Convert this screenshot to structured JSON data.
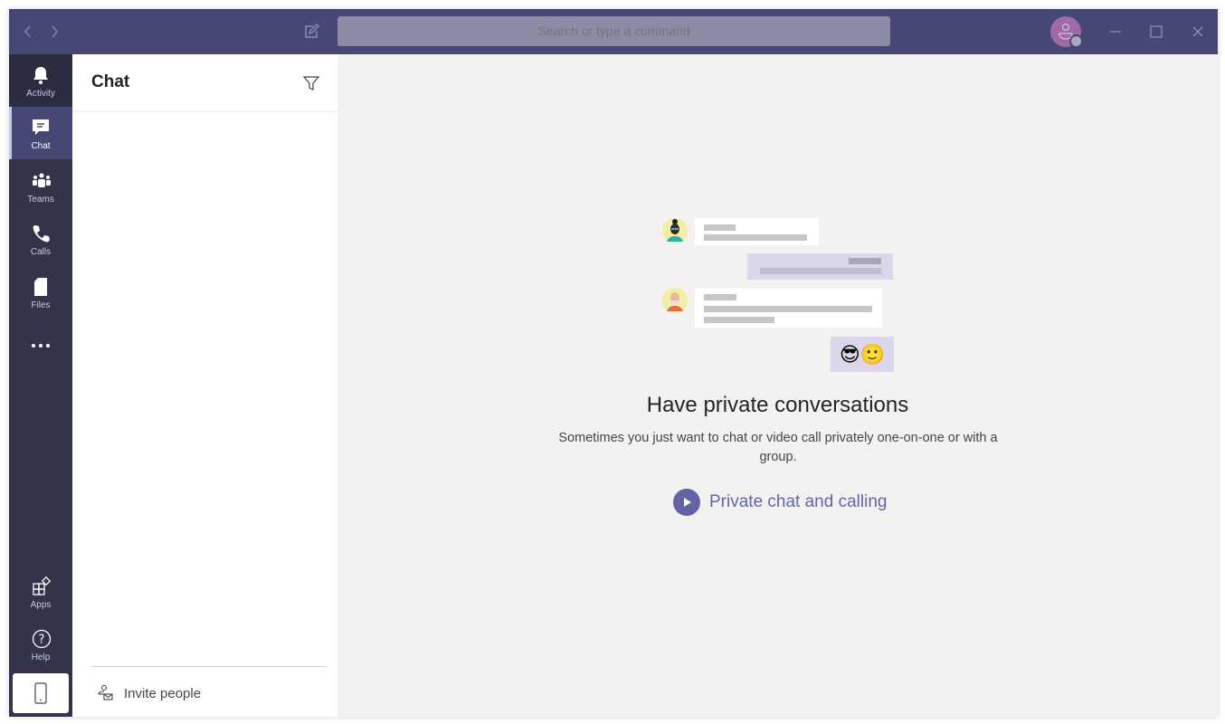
{
  "titlebar": {
    "back_icon": "chevron-left-icon",
    "forward_icon": "chevron-right-icon",
    "compose_icon": "compose-icon",
    "search_placeholder": "Search or type a command",
    "avatar_status": "offline",
    "minimize_icon": "minimize-icon",
    "maximize_icon": "maximize-icon",
    "close_icon": "close-icon"
  },
  "rail": {
    "items": [
      {
        "label": "Activity",
        "icon": "bell-icon"
      },
      {
        "label": "Chat",
        "icon": "chat-icon",
        "active": true
      },
      {
        "label": "Teams",
        "icon": "teams-icon"
      },
      {
        "label": "Calls",
        "icon": "phone-icon"
      },
      {
        "label": "Files",
        "icon": "file-icon"
      },
      {
        "label": "",
        "icon": "more-icon"
      }
    ],
    "bottom": [
      {
        "label": "Apps",
        "icon": "apps-icon"
      },
      {
        "label": "Help",
        "icon": "help-icon"
      },
      {
        "label": "",
        "icon": "mobile-icon"
      }
    ]
  },
  "chat_list": {
    "title": "Chat",
    "filter_icon": "filter-icon",
    "invite_label": "Invite people"
  },
  "empty_state": {
    "heading": "Have private conversations",
    "description": "Sometimes you just want to chat or video call privately one-on-one or with a group.",
    "cta_label": "Private chat and calling",
    "emojis": [
      "😎",
      "🙂"
    ]
  },
  "colors": {
    "titlebar": "#464775",
    "rail": "#33344a",
    "accent": "#6264a7",
    "background": "#f3f2f1"
  }
}
